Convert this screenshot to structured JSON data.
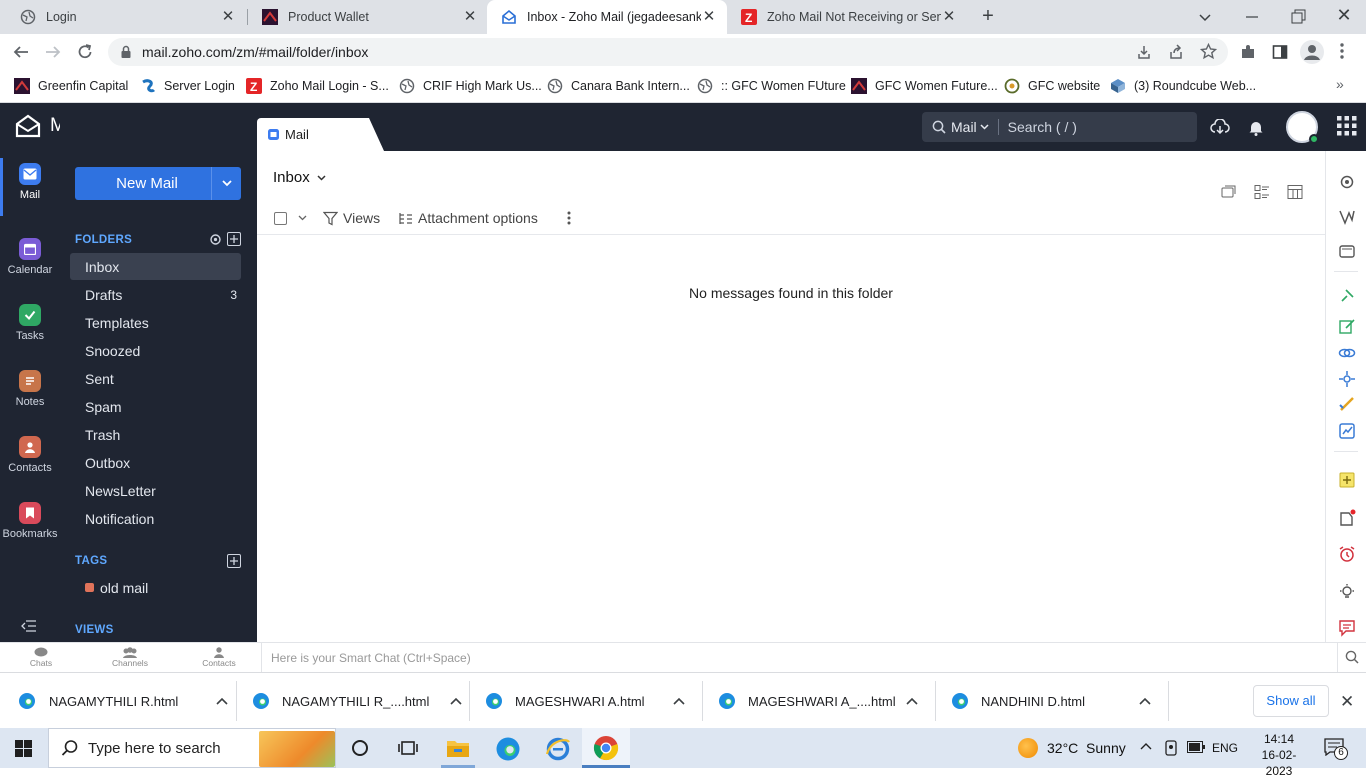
{
  "browser": {
    "tabs": [
      {
        "title": "Login",
        "active": false
      },
      {
        "title": "Product Wallet",
        "active": false
      },
      {
        "title": "Inbox - Zoho Mail (jegadeesank@",
        "active": true
      },
      {
        "title": "Zoho Mail Not Receiving or Send",
        "active": false
      }
    ],
    "url": "mail.zoho.com/zm/#mail/folder/inbox",
    "bookmarks": [
      "Greenfin Capital",
      "Server Login",
      "Zoho Mail Login - S...",
      "CRIF High Mark Us...",
      "Canara Bank Intern...",
      ":: GFC Women FUture",
      "GFC Women Future...",
      "GFC website",
      "(3) Roundcube Web..."
    ]
  },
  "app": {
    "brand": "Mail",
    "rail": [
      {
        "label": "Mail",
        "icon": "mail-icon",
        "color": "#3d7cf0"
      },
      {
        "label": "Calendar",
        "icon": "calendar-icon",
        "color": "#7b5cd6"
      },
      {
        "label": "Tasks",
        "icon": "check-icon",
        "color": "#2fa864"
      },
      {
        "label": "Notes",
        "icon": "notes-icon",
        "color": "#c7754a"
      },
      {
        "label": "Contacts",
        "icon": "contact-icon",
        "color": "#d0684f"
      },
      {
        "label": "Bookmarks",
        "icon": "bookmark-icon",
        "color": "#d94a5b"
      }
    ],
    "new_mail": "New Mail",
    "folders_heading": "FOLDERS",
    "folders": [
      {
        "name": "Inbox",
        "count": ""
      },
      {
        "name": "Drafts",
        "count": "3"
      },
      {
        "name": "Templates",
        "count": ""
      },
      {
        "name": "Snoozed",
        "count": ""
      },
      {
        "name": "Sent",
        "count": ""
      },
      {
        "name": "Spam",
        "count": ""
      },
      {
        "name": "Trash",
        "count": ""
      },
      {
        "name": "Outbox",
        "count": ""
      },
      {
        "name": "NewsLetter",
        "count": ""
      },
      {
        "name": "Notification",
        "count": ""
      }
    ],
    "tags_heading": "TAGS",
    "tags": [
      {
        "name": "old mail",
        "color": "#e0735a"
      }
    ],
    "views_heading": "VIEWS",
    "top_tab": "Mail",
    "search_scope": "Mail",
    "search_placeholder": "Search ( / )",
    "folder_title": "Inbox",
    "toolbar": {
      "views": "Views",
      "attachment": "Attachment options"
    },
    "empty_message": "No messages found in this folder",
    "chat": {
      "items": [
        "Chats",
        "Channels",
        "Contacts"
      ],
      "placeholder": "Here is your Smart Chat (Ctrl+Space)"
    }
  },
  "downloads": {
    "items": [
      "NAGAMYTHILI R.html",
      "NAGAMYTHILI R_....html",
      "MAGESHWARI A.html",
      "MAGESHWARI A_....html",
      "NANDHINI D.html"
    ],
    "show_all": "Show all"
  },
  "taskbar": {
    "search_placeholder": "Type here to search",
    "weather": "32°C  Sunny",
    "lang": "ENG",
    "time": "14:14",
    "date": "16-02-2023",
    "notifications": "6"
  }
}
